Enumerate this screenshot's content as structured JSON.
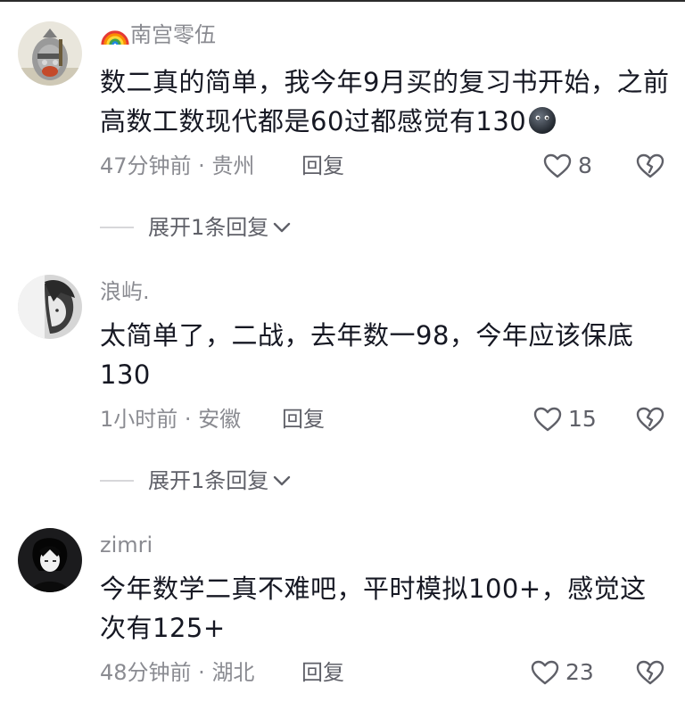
{
  "colors": {
    "text_primary": "#161823",
    "text_secondary": "#8a8b91",
    "action_text": "#5f6068"
  },
  "comments": [
    {
      "username": "南宫零伍",
      "username_prefix_icon": "rainbow-emoji",
      "avatar": "knight-cartoon-avatar",
      "text": "数二真的简单，我今年9月买的复习书开始，之前高数工数现代都是60过都感觉有130",
      "text_suffix_icon": "dark-ball-emoji",
      "time": "47分钟前",
      "location": "贵州",
      "reply_label": "回复",
      "likes": "8",
      "expand_label": "展开1条回复"
    },
    {
      "username": "浪屿.",
      "avatar": "monochrome-anime-avatar",
      "text": "太简单了，二战，去年数一98，今年应该保底130",
      "time": "1小时前",
      "location": "安徽",
      "reply_label": "回复",
      "likes": "15",
      "expand_label": "展开1条回复"
    },
    {
      "username": "zimri",
      "avatar": "dark-anime-avatar",
      "text": "今年数学二真不难吧，平时模拟100+，感觉这次有125+",
      "time": "48分钟前",
      "location": "湖北",
      "reply_label": "回复",
      "likes": "23"
    }
  ],
  "meta_separator": " · "
}
